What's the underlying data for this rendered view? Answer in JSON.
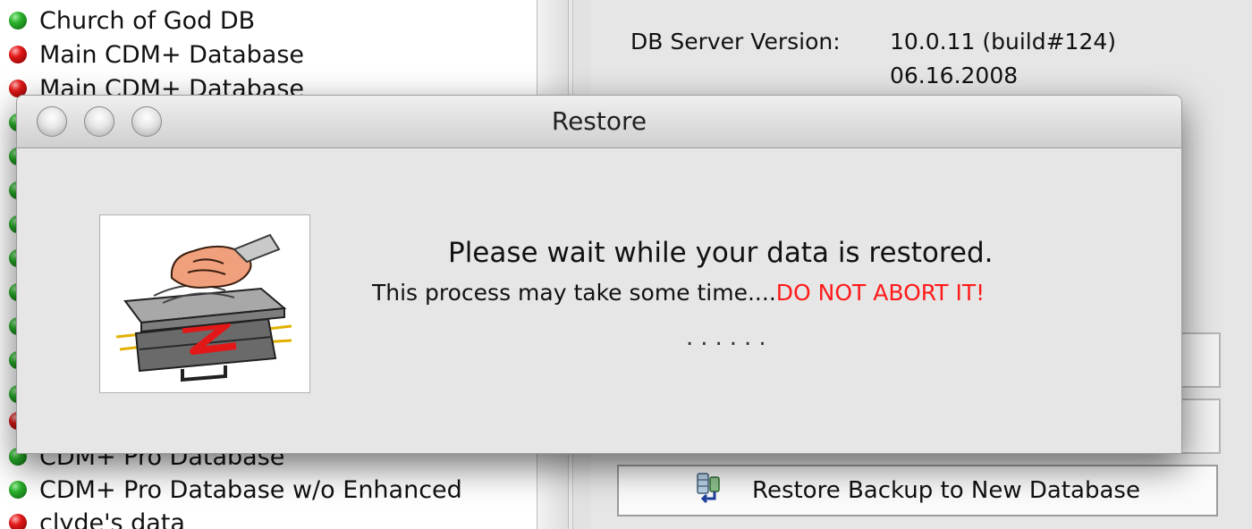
{
  "db_list": {
    "items": [
      {
        "label": "Church of God DB",
        "status": "green"
      },
      {
        "label": "Main CDM+ Database",
        "status": "red"
      },
      {
        "label": "Main CDM+ Database",
        "status": "red"
      },
      {
        "label": "CDM+ Pro Database",
        "status": "green"
      },
      {
        "label": "CDM+ Pro Database w/o Enhanced",
        "status": "green"
      },
      {
        "label": "clyde's data",
        "status": "red"
      }
    ],
    "hidden_dot_statuses": [
      "green",
      "green",
      "green",
      "green",
      "green",
      "green",
      "green",
      "green",
      "green",
      "red"
    ]
  },
  "server_info": {
    "db_server_version_label": "DB Server Version:",
    "db_server_version_value": "10.0.11 (build#124)",
    "db_server_version_date": "06.16.2008"
  },
  "buttons": {
    "restore_backup_new_db": "Restore Backup to New Database"
  },
  "dialog": {
    "title": "Restore",
    "wait_message": "Please wait while your data is restored.",
    "process_message": "This process may take some time....",
    "abort_warning": "DO NOT ABORT IT!",
    "progress": "......"
  },
  "colors": {
    "warning": "#ff1a1a",
    "status_green": "#2bb22b",
    "status_red": "#e21818"
  }
}
